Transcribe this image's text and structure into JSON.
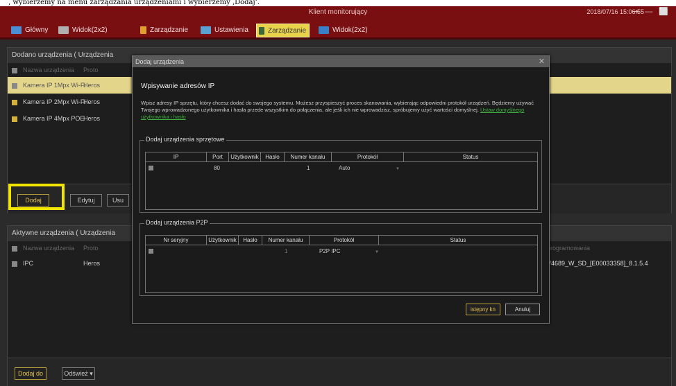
{
  "caption_strip": "‚ wybierzemy na menu zarządzania urządzeniami i wybierzemy ‚Dodaj‘.",
  "titlebar": {
    "title": "Klient monitorujący",
    "datetime": "2018/07/16 15:06:55",
    "controls": "⇥ — ⬜"
  },
  "tabs": [
    {
      "label": "Główny",
      "icon": "home-icon",
      "color": "#4a8fd6"
    },
    {
      "label": "Widok(2x2)",
      "icon": "grid-view-icon",
      "color": "#b0b0b0"
    },
    {
      "label": "Zarządzanie",
      "icon": "person-icon",
      "color": "#e0a030"
    },
    {
      "label": "Ustawienia",
      "icon": "settings-icon",
      "color": "#5aa0d0"
    },
    {
      "label": "Zarządzanie",
      "icon": "device-icon",
      "color": "#3a6a3a",
      "active": true
    },
    {
      "label": "Widok(2x2)",
      "icon": "view-icon",
      "color": "#3a80c8"
    }
  ],
  "added_panel": {
    "header": "Dodano urządzenia  ( Urządzenia",
    "columns": [
      "Nazwa urządzenia",
      "Proto"
    ],
    "rows": [
      {
        "name": "Kamera IP 1Mpx Wi-Fi",
        "proto": "Heros",
        "selected": true
      },
      {
        "name": "Kamera IP 2Mpx Wi-Fi",
        "proto": "Heros",
        "checked": true
      },
      {
        "name": "Kamera IP 4Mpx POE",
        "proto": "Heros",
        "checked": true
      }
    ],
    "buttons": {
      "add": "Dodaj",
      "edit": "Edytuj",
      "remove": "Usu"
    }
  },
  "active_panel": {
    "header": "Aktywne urządzenia  ( Urządzenia",
    "columns": [
      "Nazwa urządzenia",
      "Proto"
    ],
    "right_col_header": "programowania",
    "rows": [
      {
        "name": "IPC",
        "proto": "Heros",
        "firmware": "V4689_W_SD_[E00033358]_8.1.5.4"
      }
    ],
    "buttons": {
      "add_to": "Dodaj do",
      "refresh": "Odśwież ▾"
    }
  },
  "modal": {
    "window_title": "Dodaj urządzenia",
    "close": "✕",
    "heading": "Wpisywanie adresów IP",
    "description_1": "Wpisz adresy IP sprzętu, który chcesz dodać do swojego systemu. Możesz przyspieszyć proces skanowania, wybierając odpowiedni protokół urządzeń. Będziemy używać Twojego wprowadzonego użytkownika i hasła przede wszystkim do połączenia, ale jeśli ich nie wprowadzisz, spróbujemy użyć wartości domyślnej.",
    "description_link": "Ustaw domyślnego użytkownika i hasło",
    "hw_section": {
      "legend": "Dodaj urządzenia sprzętowe",
      "columns": [
        "IP",
        "Port",
        "Użytkownik",
        "Hasło",
        "Numer kanału",
        "Protokół",
        "Status"
      ],
      "row": {
        "port": "80",
        "channel": "1",
        "protocol": "Auto"
      }
    },
    "p2p_section": {
      "legend": "Dodaj urządzenia P2P",
      "columns": [
        "Nr seryjny",
        "Użytkownik",
        "Hasło",
        "Numer kanału",
        "Protokół",
        "Status"
      ],
      "row": {
        "channel": "1",
        "protocol": "P2P IPC"
      }
    },
    "buttons": {
      "next": "istępny kn",
      "cancel": "Anuluj"
    }
  },
  "colors": {
    "titlebar": "#7a0f12",
    "active_tab": "#e9d34a",
    "highlight_box": "#f0e400",
    "accent_gold": "#e0c050",
    "link_green": "#3fae3f"
  }
}
